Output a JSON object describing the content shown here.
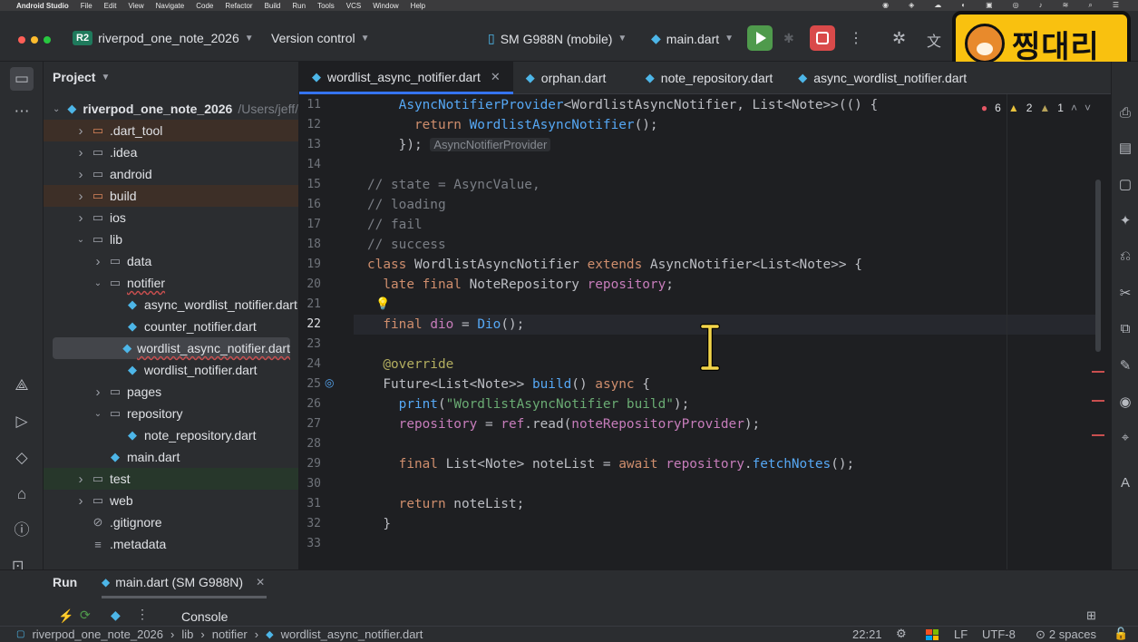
{
  "mac_menubar": {
    "app_name": "Android Studio",
    "menus": [
      "File",
      "Edit",
      "View",
      "Navigate",
      "Code",
      "Refactor",
      "Build",
      "Run",
      "Tools",
      "VCS",
      "Window",
      "Help"
    ]
  },
  "titlebar": {
    "project_badge": "R2",
    "project_name": "riverpod_one_note_2026",
    "version_control": "Version control",
    "device": "SM G988N (mobile)",
    "run_config": "main.dart",
    "watermark_text": "찡대리"
  },
  "project_panel": {
    "title": "Project",
    "rows": [
      {
        "label": "riverpod_one_note_2026",
        "path": "/Users/jeff/",
        "chev": "v",
        "icon": "dart-project-icon",
        "depth": 0,
        "bold": true
      },
      {
        "label": ".dart_tool",
        "chev": ">",
        "icon": "folder-icon",
        "depth": 1,
        "bg": "#3d2f27"
      },
      {
        "label": ".idea",
        "chev": ">",
        "icon": "folder-icon",
        "depth": 1
      },
      {
        "label": "android",
        "chev": ">",
        "icon": "folder-icon",
        "depth": 1
      },
      {
        "label": "build",
        "chev": ">",
        "icon": "folder-icon",
        "depth": 1,
        "bg": "#3d2f27"
      },
      {
        "label": "ios",
        "chev": ">",
        "icon": "folder-icon",
        "depth": 1
      },
      {
        "label": "lib",
        "chev": "v",
        "icon": "folder-icon",
        "depth": 1
      },
      {
        "label": "data",
        "chev": ">",
        "icon": "folder-icon",
        "depth": 2
      },
      {
        "label": "notifier",
        "chev": "v",
        "icon": "folder-icon",
        "depth": 2,
        "underline": true
      },
      {
        "label": "async_wordlist_notifier.dart",
        "chev": "",
        "icon": "dart-file-icon",
        "depth": 3
      },
      {
        "label": "counter_notifier.dart",
        "chev": "",
        "icon": "dart-file-icon",
        "depth": 3
      },
      {
        "label": "wordlist_async_notifier.dart",
        "chev": "",
        "icon": "dart-file-icon",
        "depth": 3,
        "selected": true,
        "underline": true
      },
      {
        "label": "wordlist_notifier.dart",
        "chev": "",
        "icon": "dart-file-icon",
        "depth": 3
      },
      {
        "label": "pages",
        "chev": ">",
        "icon": "folder-icon",
        "depth": 2
      },
      {
        "label": "repository",
        "chev": "v",
        "icon": "folder-icon",
        "depth": 2
      },
      {
        "label": "note_repository.dart",
        "chev": "",
        "icon": "dart-file-icon",
        "depth": 3
      },
      {
        "label": "main.dart",
        "chev": "",
        "icon": "dart-file-icon",
        "depth": 2
      },
      {
        "label": "test",
        "chev": ">",
        "icon": "folder-icon",
        "depth": 1,
        "bg": "#27372b"
      },
      {
        "label": "web",
        "chev": ">",
        "icon": "folder-icon",
        "depth": 1
      },
      {
        "label": ".gitignore",
        "chev": "",
        "icon": "ignore-file-icon",
        "depth": 1
      },
      {
        "label": ".metadata",
        "chev": "",
        "icon": "text-file-icon",
        "depth": 1
      }
    ]
  },
  "editor": {
    "tabs": [
      {
        "label": "wordlist_async_notifier.dart",
        "active": true,
        "closable": true
      },
      {
        "label": "orphan.dart"
      },
      {
        "label": "note_repository.dart"
      },
      {
        "label": "async_wordlist_notifier.dart"
      }
    ],
    "inspection": {
      "errors": "6",
      "warnings": "2",
      "weak_warnings": "1"
    },
    "current_line": 22,
    "lines": [
      {
        "n": 11,
        "html": "    <span class='f'>AsyncNotifierProvider</span>&lt;WordlistAsyncNotifier, List&lt;Note&gt;&gt;(() {"
      },
      {
        "n": 12,
        "html": "      <span class='k'>return</span> <span class='f'>WordlistAsyncNotifier</span>();"
      },
      {
        "n": 13,
        "html": "    }); <span class='hint'>AsyncNotifierProvider</span>"
      },
      {
        "n": 14,
        "html": ""
      },
      {
        "n": 15,
        "html": "<span class='c'>// state = AsyncValue,</span>"
      },
      {
        "n": 16,
        "html": "<span class='c'>// loading</span>"
      },
      {
        "n": 17,
        "html": "<span class='c'>// fail</span>"
      },
      {
        "n": 18,
        "html": "<span class='c'>// success</span>"
      },
      {
        "n": 19,
        "html": "<span class='k'>class</span> WordlistAsyncNotifier <span class='k'>extends</span> AsyncNotifier&lt;List&lt;Note&gt;&gt; {"
      },
      {
        "n": 20,
        "html": "  <span class='k'>late final</span> NoteRepository <span class='p'>repository</span>;"
      },
      {
        "n": 21,
        "html": ""
      },
      {
        "n": 22,
        "html": "  <span class='k'>final</span> <span class='p'>dio</span> = <span class='f'>Dio</span>();"
      },
      {
        "n": 23,
        "html": ""
      },
      {
        "n": 24,
        "html": "  <span class='a'>@override</span>"
      },
      {
        "n": 25,
        "html": "  Future&lt;List&lt;Note&gt;&gt; <span class='f'>build</span>() <span class='k'>async</span> {"
      },
      {
        "n": 26,
        "html": "    <span class='f'>print</span>(<span class='s'>\"WordlistAsyncNotifier build\"</span>);"
      },
      {
        "n": 27,
        "html": "    <span class='p'>repository</span> = <span class='p'>ref</span>.read(<span class='p'>noteRepositoryProvider</span>);"
      },
      {
        "n": 28,
        "html": ""
      },
      {
        "n": 29,
        "html": "    <span class='k'>final</span> List&lt;Note&gt; noteList = <span class='k'>await</span> <span class='p'>repository</span>.<span class='f'>fetchNotes</span>();"
      },
      {
        "n": 30,
        "html": ""
      },
      {
        "n": 31,
        "html": "    <span class='k'>return</span> noteList;"
      },
      {
        "n": 32,
        "html": "  }"
      },
      {
        "n": 33,
        "html": ""
      }
    ]
  },
  "run_panel": {
    "title": "Run",
    "config_tab": "main.dart (SM G988N)",
    "console_label": "Console"
  },
  "statusbar": {
    "breadcrumb": [
      "riverpod_one_note_2026",
      "lib",
      "notifier",
      "wordlist_async_notifier.dart"
    ],
    "position": "22:21",
    "line_sep": "LF",
    "encoding": "UTF-8",
    "indent": "2 spaces"
  }
}
